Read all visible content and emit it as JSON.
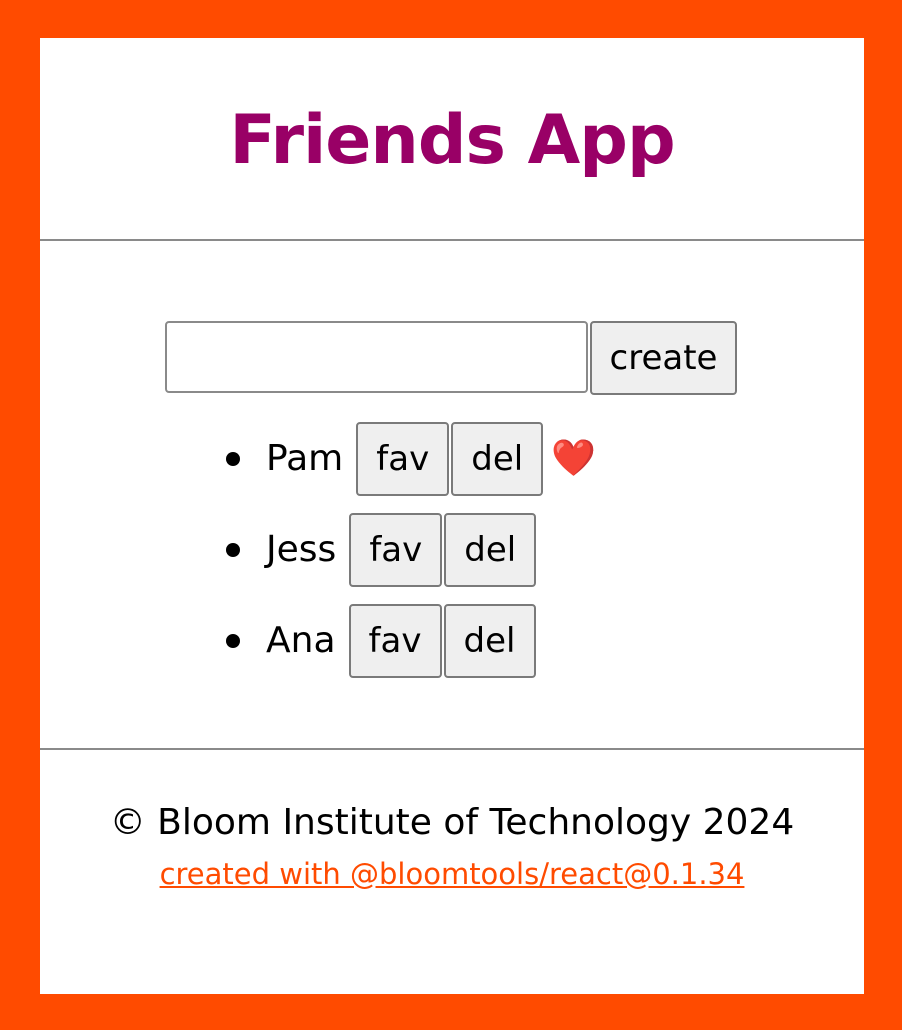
{
  "header": {
    "title": "Friends App"
  },
  "create_form": {
    "input_value": "",
    "placeholder": "",
    "create_label": "create"
  },
  "friends": [
    {
      "name": "Pam",
      "fav_label": "fav",
      "del_label": "del",
      "favorite": true,
      "favorite_symbol": "❤️"
    },
    {
      "name": "Jess",
      "fav_label": "fav",
      "del_label": "del",
      "favorite": false
    },
    {
      "name": "Ana",
      "fav_label": "fav",
      "del_label": "del",
      "favorite": false
    }
  ],
  "footer": {
    "copyright": "© Bloom Institute of Technology 2024",
    "credit_link": "created with @bloomtools/react@0.1.34"
  },
  "colors": {
    "page_background": "#ff4b00",
    "title": "#990066",
    "link": "#ff4b00",
    "heart": "#e0141e"
  }
}
